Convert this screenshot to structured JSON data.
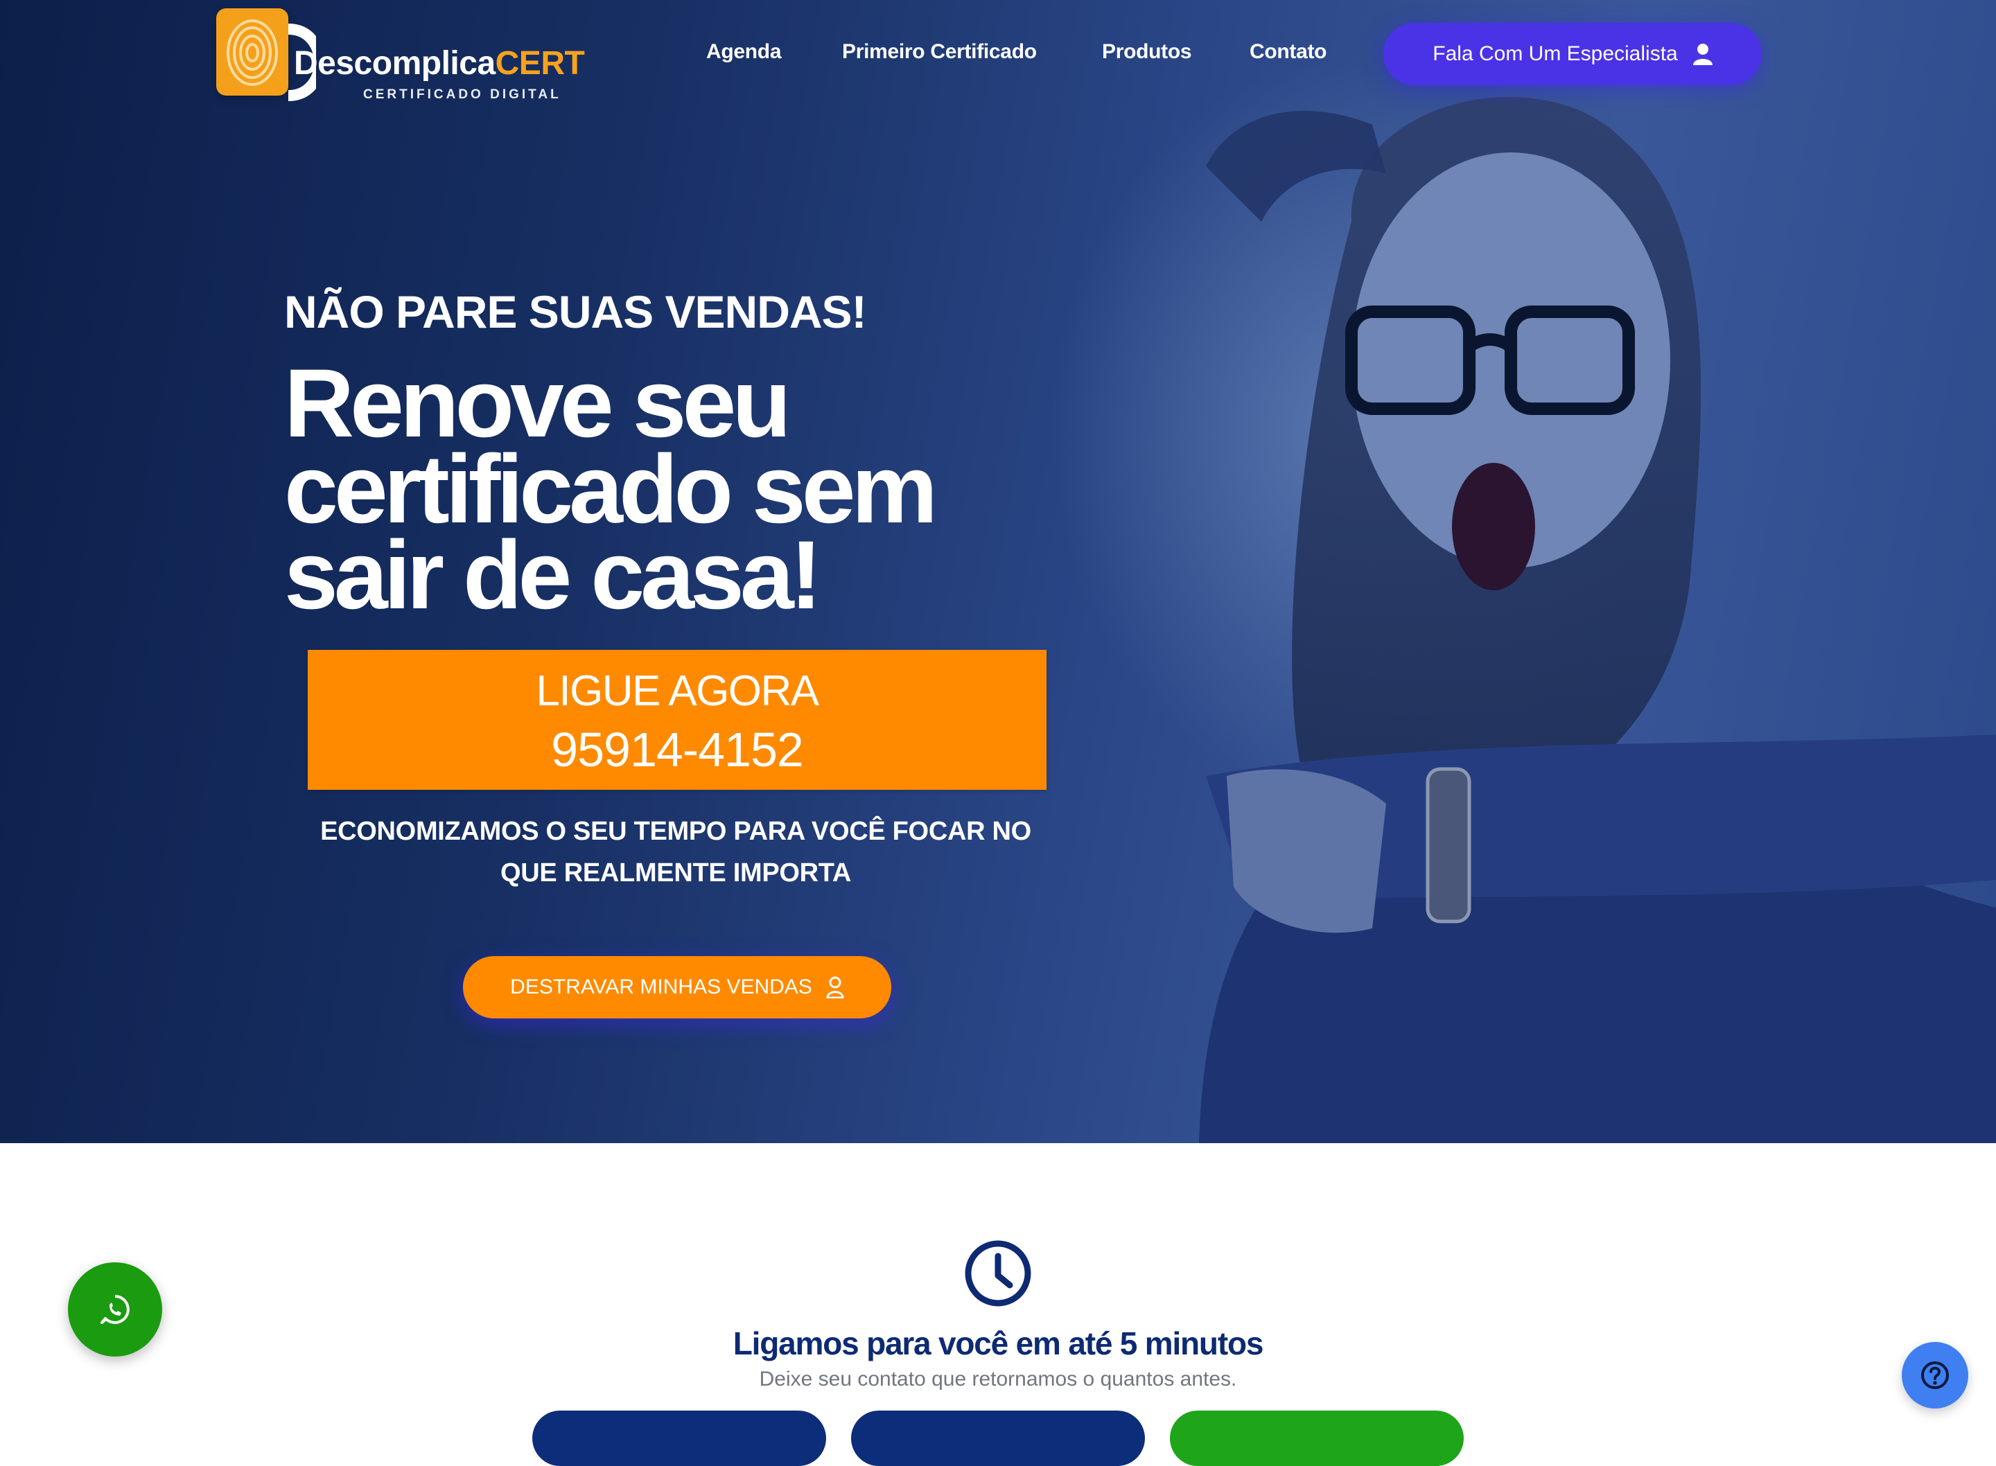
{
  "brand": {
    "name_prefix": "Descomplica",
    "name_accent": "CERT",
    "tagline": "CERTIFICADO DIGITAL",
    "logo_icon": "fingerprint-icon",
    "accent_color": "#ff8a00",
    "primary_color": "#4a33e6",
    "navy_color": "#0d2a73"
  },
  "nav": {
    "items": [
      {
        "label": "Agenda"
      },
      {
        "label": "Primeiro Certificado"
      },
      {
        "label": "Produtos"
      },
      {
        "label": "Contato"
      }
    ],
    "cta_label": "Fala Com Um Especialista",
    "cta_icon": "user-icon"
  },
  "hero": {
    "kicker": "NÃO PARE SUAS VENDAS!",
    "headline": "Renove seu certificado sem sair de casa!",
    "call_label": "LIGUE AGORA",
    "phone": "95914-4152",
    "tagline": "ECONOMIZAMOS O SEU TEMPO PARA VOCÊ FOCAR NO QUE REALMENTE IMPORTA",
    "cta_label": "DESTRAVAR MINHAS VENDAS",
    "cta_icon": "user-outline-icon"
  },
  "callback": {
    "icon": "clock-icon",
    "title": "Ligamos para você em até 5 minutos",
    "subtitle": "Deixe seu contato que retornamos o quantos antes."
  },
  "floating": {
    "whatsapp_icon": "whatsapp-icon",
    "whatsapp_color": "#1a9b10",
    "help_icon": "help-icon",
    "help_color": "#3f7ff1"
  }
}
